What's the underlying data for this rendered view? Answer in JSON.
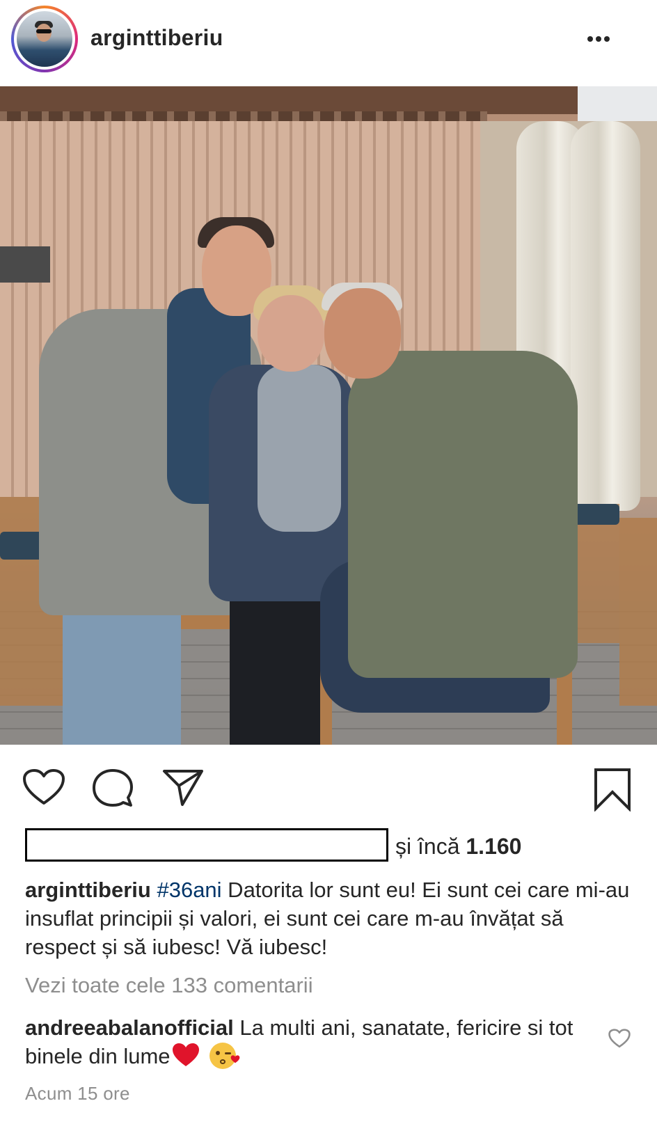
{
  "header": {
    "username": "arginttiberiu",
    "more_icon": "more-horizontal-icon"
  },
  "actions": {
    "like_icon": "heart-outline-icon",
    "comment_icon": "comment-bubble-icon",
    "share_icon": "paper-plane-icon",
    "save_icon": "bookmark-outline-icon"
  },
  "likes": {
    "prefix": "și încă",
    "count": "1.160"
  },
  "caption": {
    "username": "arginttiberiu",
    "hashtag": "#36ani",
    "text": " Datorita lor sunt eu! Ei sunt cei care mi-au insuflat principii și valori, ei sunt cei care m-au învățat să respect și să iubesc! Vă iubesc!"
  },
  "view_all_comments": "Vezi toate cele 133 comentarii",
  "top_comment": {
    "username": "andreeabalanofficial",
    "text": " La multi ani, sanatate, fericire si tot binele din lume",
    "emojis": [
      "red-heart-emoji",
      "face-blowing-kiss-emoji"
    ],
    "like_icon": "heart-outline-small-icon"
  },
  "timestamp": "Acum 15 ore",
  "colors": {
    "text": "#262626",
    "muted": "#8e8e8e",
    "hashtag": "#003569",
    "heart_emoji": "#e0142b"
  }
}
